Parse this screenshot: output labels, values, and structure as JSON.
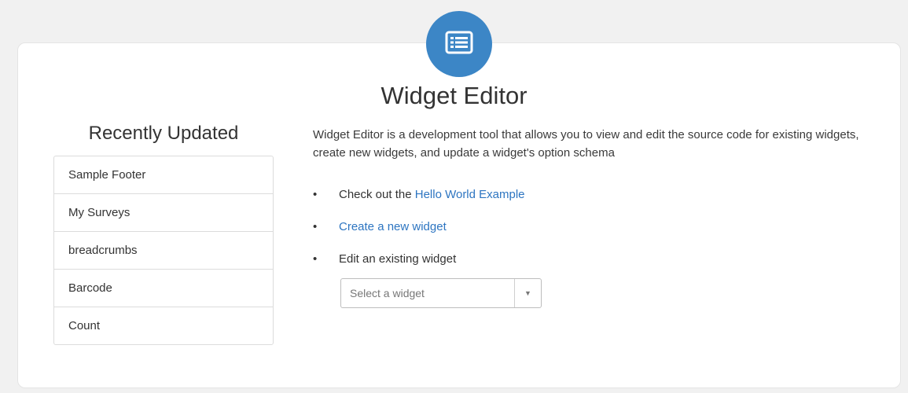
{
  "page": {
    "title": "Widget Editor",
    "description": "Widget Editor is a development tool that allows you to view and edit the source code for existing widgets, create new widgets, and update a widget's option schema",
    "icon": "list-view-icon",
    "accent_color": "#3c86c6",
    "link_color": "#2d75c1"
  },
  "recent": {
    "title": "Recently Updated",
    "items": [
      {
        "label": "Sample Footer"
      },
      {
        "label": "My Surveys"
      },
      {
        "label": "breadcrumbs"
      },
      {
        "label": "Barcode"
      },
      {
        "label": "Count"
      }
    ]
  },
  "bullets": {
    "hello_prefix": "Check out the ",
    "hello_link": "Hello World Example",
    "create_link": "Create a new widget",
    "edit_text": "Edit an existing widget",
    "marker": "•"
  },
  "select": {
    "placeholder": "Select a widget",
    "arrow": "▼"
  }
}
